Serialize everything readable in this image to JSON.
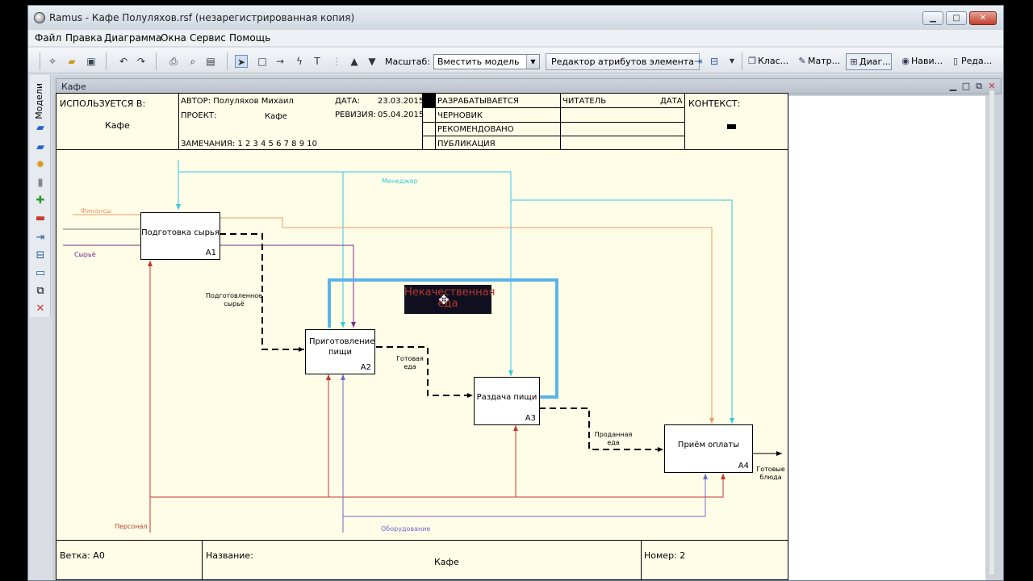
{
  "window": {
    "title": "Ramus - Кафе  Полуляхов.rsf (незарегистрированная копия)",
    "min_icon": "minimize-icon",
    "max_icon": "maximize-icon",
    "close_icon": "close-icon"
  },
  "menu": [
    "Файл",
    "Правка",
    "Диаграмма",
    "Окна",
    "Сервис",
    "Помощь"
  ],
  "toolbar": {
    "scale_label": "Масштаб:",
    "scale_value": "Вместить модель",
    "attr_editor": "Редактор атрибутов элемента",
    "tabs": [
      {
        "label": "Клас...",
        "icon": "classifier-icon"
      },
      {
        "label": "Матр...",
        "icon": "matrix-icon"
      },
      {
        "label": "Диаг...",
        "icon": "diagram-icon"
      },
      {
        "label": "Нави...",
        "icon": "navigator-icon"
      },
      {
        "label": "Реда...",
        "icon": "editor-icon"
      }
    ]
  },
  "left_panel": {
    "label": "Модели"
  },
  "document": {
    "tab_title": "Кафе"
  },
  "header": {
    "used_in_label": "ИСПОЛЬЗУЕТСЯ В:",
    "used_in_value": "Кафе",
    "author_label": "АВТОР: Полуляхов Михаил",
    "project_label": "ПРОЕКТ:",
    "project_value": "Кафе",
    "date_label": "ДАТА:",
    "date_value": "23.03.2015",
    "revision_label": "РЕВИЗИЯ:",
    "revision_value": "05.04.2015",
    "notes_label": "ЗАМЕЧАНИЯ:  1  2  3  4  5  6  7  8  9  10",
    "status": [
      "РАЗРАБАТЫВАЕТСЯ",
      "ЧЕРНОВИК",
      "РЕКОМЕНДОВАНО",
      "ПУБЛИКАЦИЯ"
    ],
    "reader_label": "ЧИТАТЕЛЬ",
    "reader_date_label": "ДАТА",
    "context_label": "КОНТЕКСТ:"
  },
  "boxes": [
    {
      "name": "Подготовка сырья",
      "num": "A1"
    },
    {
      "name": "Приготовление пищи",
      "num": "A2"
    },
    {
      "name": "Раздача пищи",
      "num": "A3"
    },
    {
      "name": "Приём оплаты",
      "num": "A4"
    }
  ],
  "arrow_labels": {
    "manager": "Менеджер",
    "finance": "Финансы",
    "raw": "Сырьё",
    "prepared_raw": "Подготовленное сырьё",
    "low_quality": "Некачественная еда",
    "ready_food": "Готовая еда",
    "sold_food": "Проданная еда",
    "ready_dishes": "Готовые блюда",
    "staff": "Персонал",
    "equipment": "Оборудование"
  },
  "footer": {
    "branch_label": "Ветка: А0",
    "name_label": "Название:",
    "name_value": "Кафе",
    "number_label": "Номер: 2"
  },
  "colors": {
    "manager": "#35c8e0",
    "finance": "#e89a6a",
    "raw": "#7a2a8a",
    "staff": "#c0392b",
    "equipment": "#6a6ac8",
    "selection": "#5ab4e8"
  }
}
